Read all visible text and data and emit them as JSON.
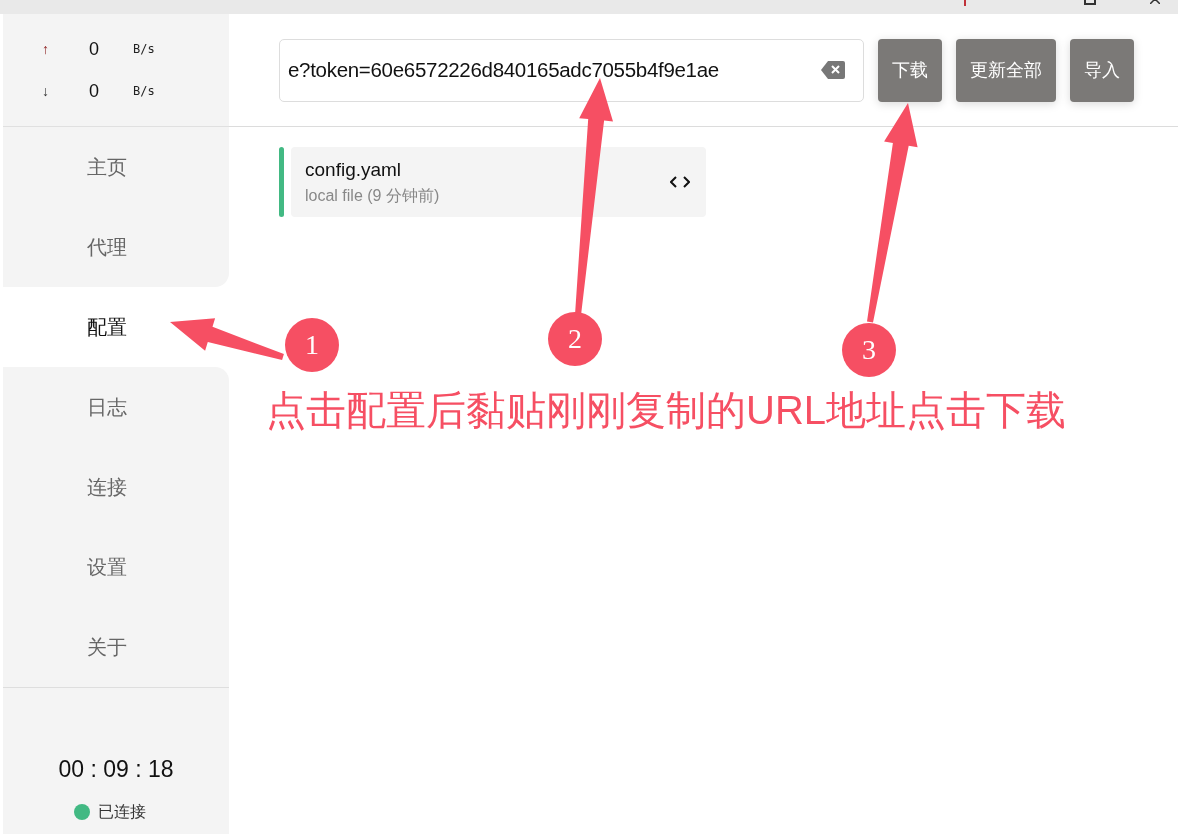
{
  "traffic": [
    {
      "kind": "up",
      "arrow": "↑",
      "value": "0",
      "unit": "B/s"
    },
    {
      "kind": "down",
      "arrow": "↓",
      "value": "0",
      "unit": "B/s"
    }
  ],
  "nav": [
    {
      "label": "主页",
      "selected": false
    },
    {
      "label": "代理",
      "selected": false
    },
    {
      "label": "配置",
      "selected": true
    },
    {
      "label": "日志",
      "selected": false
    },
    {
      "label": "连接",
      "selected": false
    },
    {
      "label": "设置",
      "selected": false
    },
    {
      "label": "关于",
      "selected": false
    }
  ],
  "timer": "00 : 09 : 18",
  "status": {
    "label": "已连接",
    "color": "#42b983"
  },
  "url_field": {
    "value": "e?token=60e6572226d840165adc7055b4f9e1ae"
  },
  "buttons": [
    "下载",
    "更新全部",
    "导入"
  ],
  "profiles": [
    {
      "name": "config.yaml",
      "detail": "local file (9 分钟前)",
      "selected": true
    }
  ],
  "annotations": {
    "markers": [
      "1",
      "2",
      "3"
    ],
    "caption": "点击配置后黏贴刚刚复制的URL地址点击下载"
  }
}
